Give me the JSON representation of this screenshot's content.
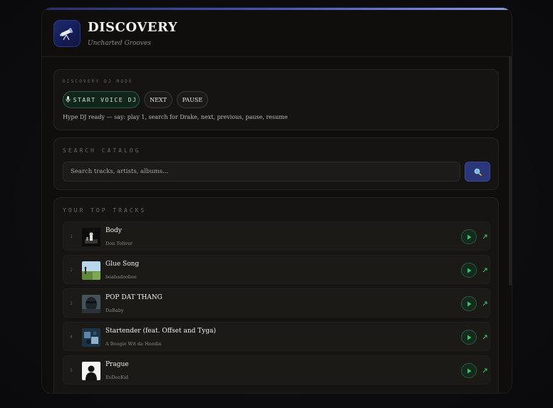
{
  "header": {
    "title": "DISCOVERY",
    "subtitle": "Uncharted Grooves",
    "logo_icon": "telescope-icon"
  },
  "dj": {
    "section_label": "DISCOVERY DJ MODE",
    "start_label": "START VOICE DJ",
    "start_icon": "microphone-icon",
    "next_label": "NEXT",
    "pause_label": "PAUSE",
    "status": "Hype DJ ready — say: play 1, search for Drake, next, previous, pause, resume"
  },
  "search": {
    "section_label": "SEARCH CATALOG",
    "placeholder": "Search tracks, artists, albums...",
    "button_icon": "search-icon"
  },
  "tracks": {
    "section_label": "YOUR TOP TRACKS",
    "items": [
      {
        "num": "1",
        "title": "Body",
        "artist": "Don Toliver"
      },
      {
        "num": "2",
        "title": "Glue Song",
        "artist": "beabadoobee"
      },
      {
        "num": "3",
        "title": "POP DAT THANG",
        "artist": "DaBaby"
      },
      {
        "num": "4",
        "title": "Startender (feat. Offset and Tyga)",
        "artist": "A Boogie Wit da Hoodie"
      },
      {
        "num": "5",
        "title": "Prague",
        "artist": "EsDeeKid"
      }
    ]
  },
  "colors": {
    "accent_blue": "#4654b8",
    "accent_green": "#3fbf6a",
    "background": "#0f0e0c"
  }
}
